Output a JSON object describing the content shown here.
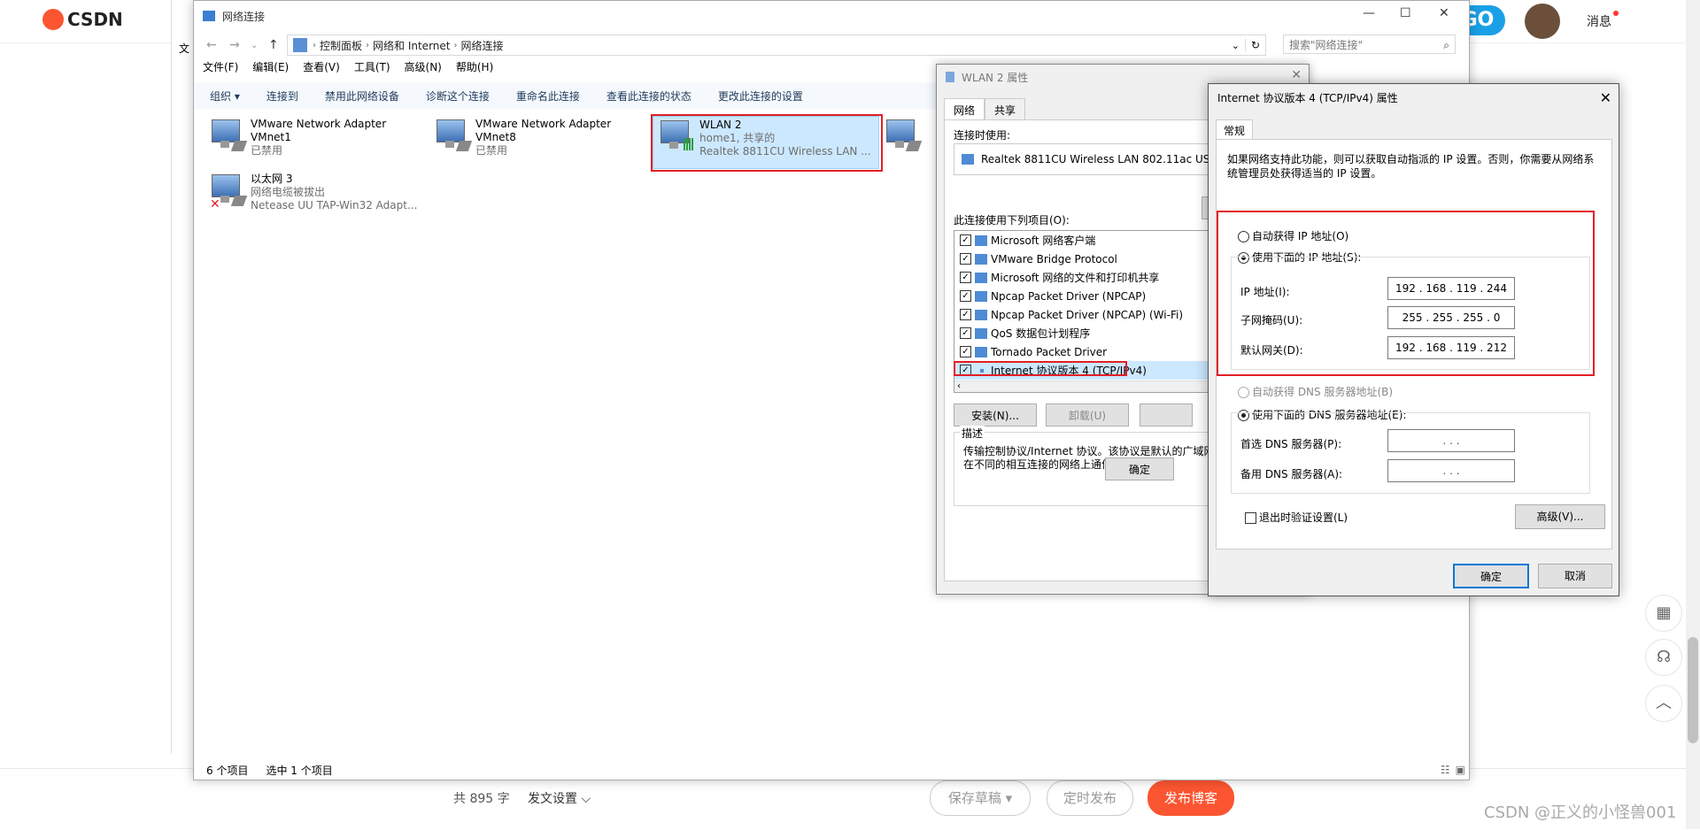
{
  "csdn": {
    "logo": "CSDN",
    "badge": "GO",
    "messages": "消息",
    "word_count": "共 895 字",
    "publish_settings": "发文设置",
    "save_draft": "保存草稿",
    "schedule": "定时发布",
    "publish": "发布博客",
    "watermark": "CSDN @正义的小怪兽001",
    "left_stub": "文"
  },
  "explorer": {
    "title": "网络连接",
    "breadcrumb": [
      "控制面板",
      "网络和 Internet",
      "网络连接"
    ],
    "search_placeholder": "搜索\"网络连接\"",
    "menu": [
      "文件(F)",
      "编辑(E)",
      "查看(V)",
      "工具(T)",
      "高级(N)",
      "帮助(H)"
    ],
    "commands": [
      "组织 ▾",
      "连接到",
      "禁用此网络设备",
      "诊断这个连接",
      "重命名此连接",
      "查看此连接的状态",
      "更改此连接的设置"
    ],
    "adapters": [
      {
        "name": "VMware Network Adapter",
        "line2": "VMnet1",
        "line3": "已禁用"
      },
      {
        "name": "VMware Network Adapter",
        "line2": "VMnet8",
        "line3": "已禁用"
      },
      {
        "name": "WLAN 2",
        "line2": "home1, 共享的",
        "line3": "Realtek 8811CU Wireless LAN ..."
      },
      {
        "name": "以太网 3",
        "line2": "网络电缆被拔出",
        "line3": "Netease UU TAP-Win32 Adapt..."
      }
    ],
    "status_count": "6 个项目",
    "status_selected": "选中 1 个项目"
  },
  "wlan_props": {
    "title": "WLAN 2 属性",
    "tabs": [
      "网络",
      "共享"
    ],
    "connect_using": "连接时使用:",
    "adapter": "Realtek 8811CU Wireless LAN 802.11ac US",
    "items_label": "此连接使用下列项目(O):",
    "items": [
      "Microsoft 网络客户端",
      "VMware Bridge Protocol",
      "Microsoft 网络的文件和打印机共享",
      "Npcap Packet Driver (NPCAP)",
      "Npcap Packet Driver (NPCAP) (Wi-Fi)",
      "QoS 数据包计划程序",
      "Tornado Packet Driver",
      "Internet 协议版本 4 (TCP/IPv4)"
    ],
    "install": "安装(N)...",
    "uninstall": "卸载(U)",
    "desc_label": "描述",
    "desc_text": "传输控制协议/Internet 协议。该协议是默认的广域网络协议，用于在不同的相互连接的网络上通信。",
    "ok": "确定"
  },
  "ipv4": {
    "title": "Internet 协议版本 4 (TCP/IPv4) 属性",
    "tab": "常规",
    "intro": "如果网络支持此功能，则可以获取自动指派的 IP 设置。否则，你需要从网络系统管理员处获得适当的 IP 设置。",
    "auto_ip": "自动获得 IP 地址(O)",
    "manual_ip": "使用下面的 IP 地址(S):",
    "ip_label": "IP 地址(I):",
    "ip_value": "192 . 168 . 119 . 244",
    "mask_label": "子网掩码(U):",
    "mask_value": "255 . 255 . 255 .  0",
    "gw_label": "默认网关(D):",
    "gw_value": "192 . 168 . 119 . 212",
    "auto_dns": "自动获得 DNS 服务器地址(B)",
    "manual_dns": "使用下面的 DNS 服务器地址(E):",
    "pref_dns_label": "首选 DNS 服务器(P):",
    "alt_dns_label": "备用 DNS 服务器(A):",
    "empty_ip": ".      .      .",
    "validate": "退出时验证设置(L)",
    "advanced": "高级(V)...",
    "ok": "确定",
    "cancel": "取消"
  }
}
